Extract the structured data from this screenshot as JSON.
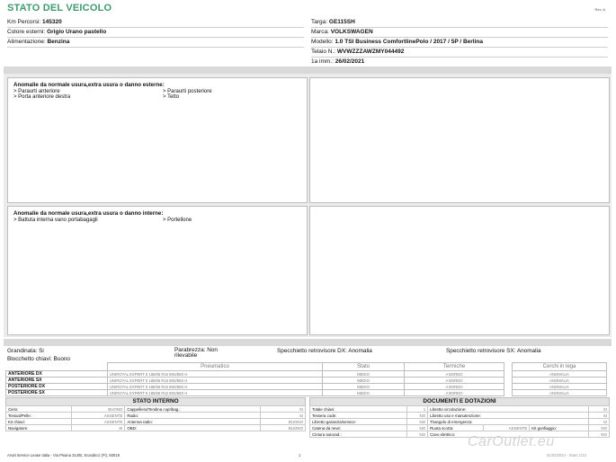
{
  "header": {
    "title": "STATO DEL VEICOLO",
    "rev": "Rev. A"
  },
  "vehicle_left": [
    {
      "label": "Km Percorsi:",
      "value": "145320"
    },
    {
      "label": "Colore esterni:",
      "value": "Grigio Urano pastello"
    },
    {
      "label": "Alimentazione:",
      "value": "Benzina"
    }
  ],
  "vehicle_right": [
    {
      "label": "Targa:",
      "value": "GE115SH"
    },
    {
      "label": "Marca:",
      "value": "VOLKSWAGEN"
    },
    {
      "label": "Modello:",
      "value": "1.0 TSI Business ComfortlinePolo / 2017 / 5P / Berlina"
    },
    {
      "label": "Telaio N.:",
      "value": "WVWZZZAWZMY044492"
    },
    {
      "label": "1a imm.:",
      "value": "26/02/2021"
    }
  ],
  "external_damage": {
    "title": "Anomalie da normale usura,extra usura o danno esterne:",
    "items": [
      "> Paraurti anteriore",
      "> Paraurti posteriore",
      "> Porta anteriore destra",
      "> Tetto"
    ]
  },
  "internal_damage": {
    "title": "Anomalie da normale usura,extra usura o danno interne:",
    "items": [
      "> Battuta interna vano portabagagli",
      "> Portellone"
    ]
  },
  "checks": {
    "grandinata": "Grandinata: Si",
    "parabrezza": "Parabrezza: Non rilevabile",
    "specchietto_dx": "Specchietto retrovisore DX: Anomalia",
    "specchietto_sx": "Specchietto retrovisore SX: Anomalia",
    "blocchetto": "Blocchetto chiavi: Buono"
  },
  "tyres": {
    "headers": {
      "pneumatico": "Pneumatico",
      "stato": "Stato",
      "termiche": "Termiche",
      "cerchi": "Cerchi in lega"
    },
    "rows": [
      {
        "pos": "ANTERIORE DX",
        "tyre": "UNIROYAL EXPERT 5 185/65 R15 88S/88S H",
        "stato": "MEDIO",
        "termiche": "A BORDO",
        "cerchi": "ANOMALIA"
      },
      {
        "pos": "ANTERIORE SX",
        "tyre": "UNIROYAL EXPERT 5 185/65 R15 88S/88S H",
        "stato": "MEDIO",
        "termiche": "A BORDO",
        "cerchi": "ANOMALIA"
      },
      {
        "pos": "POSTERIORE DX",
        "tyre": "UNIROYAL EXPERT 5 185/65 R15 88S/88S H",
        "stato": "MEDIO",
        "termiche": "A BORDO",
        "cerchi": "ANOMALIA"
      },
      {
        "pos": "POSTERIORE SX",
        "tyre": "UNIROYAL EXPERT 5 185/65 R15 88S/88S H",
        "stato": "MEDIO",
        "termiche": "A BORDO",
        "cerchi": "ANOMALIA"
      }
    ]
  },
  "interior": {
    "title": "STATO INTERNO",
    "rows": [
      [
        {
          "k": "Cielo:",
          "v": "BUONO"
        },
        {
          "k": "Cappelliera/Tendina copribag.:",
          "v": "SI"
        }
      ],
      [
        {
          "k": "Tessuti/Pelle:",
          "v": "ASSENTE"
        },
        {
          "k": "Radio:",
          "v": "SI"
        }
      ],
      [
        {
          "k": "Kit chiavi:",
          "v": "ASSENTE"
        },
        {
          "k": "Antenna radio:",
          "v": "BUONO"
        }
      ],
      [
        {
          "k": "Navigatore:",
          "v": "SI"
        },
        {
          "k": "OBD:",
          "v": "BUONO"
        }
      ]
    ]
  },
  "documents": {
    "title": "DOCUMENTI E DOTAZIONI",
    "rows": [
      [
        {
          "k": "Totale chiavi:",
          "v": "1"
        },
        {
          "k": "Libretto circolazione:",
          "v": "SI"
        }
      ],
      [
        {
          "k": "Tessera code:",
          "v": "NO"
        },
        {
          "k": "Libretto uso e manutenzione:",
          "v": "SI"
        }
      ],
      [
        {
          "k": "Libretto garanzia/service:",
          "v": "NO"
        },
        {
          "k": "Triangolo di emergenza:",
          "v": "SI"
        }
      ],
      [
        {
          "k": "Catena da neve:",
          "v": "NO"
        },
        {
          "k": "Ruota scorta:",
          "v": "ASSENTE"
        },
        {
          "k": "Kit gonfiaggio:",
          "v": "NO"
        }
      ],
      [
        {
          "k": "Cintura autorad.:",
          "v": "NO"
        },
        {
          "k": "Cavo elettrico:",
          "v": "NO"
        }
      ]
    ]
  },
  "footer": {
    "company": "Arval Service Lease Italia - Via Pisana 314/B, Scandicci (FI), 50018",
    "page": "1",
    "right": "01/03/2024 - Stato 1/23",
    "watermark": "CarOutlet.eu"
  }
}
